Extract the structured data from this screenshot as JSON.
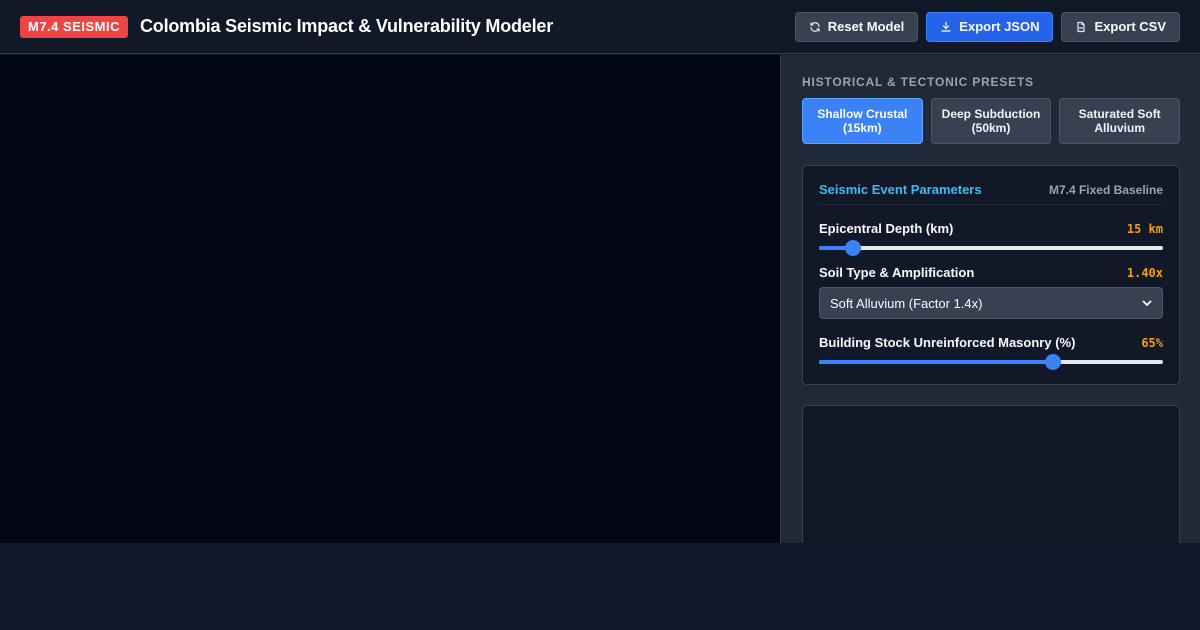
{
  "header": {
    "badge": "M7.4 SEISMIC",
    "title": "Colombia Seismic Impact & Vulnerability Modeler",
    "buttons": {
      "reset": "Reset Model",
      "export_json": "Export JSON",
      "export_csv": "Export CSV"
    }
  },
  "presets": {
    "label": "HISTORICAL & TECTONIC PRESETS",
    "items": [
      {
        "label": "Shallow Crustal (15km)",
        "active": true
      },
      {
        "label": "Deep Subduction (50km)",
        "active": false
      },
      {
        "label": "Saturated Soft Alluvium",
        "active": false
      }
    ]
  },
  "params": {
    "title": "Seismic Event Parameters",
    "subtitle": "M7.4 Fixed Baseline",
    "depth": {
      "label": "Epicentral Depth (km)",
      "value_text": "15 km",
      "fraction": 0.1
    },
    "soil": {
      "label": "Soil Type & Amplification",
      "value_text": "1.40x",
      "selected": "Soft Alluvium (Factor 1.4x)"
    },
    "masonry": {
      "label": "Building Stock Unreinforced Masonry (%)",
      "value_text": "65%",
      "fraction": 0.68
    }
  },
  "colors": {
    "badge": "#ef4444",
    "accent": "#3b82f6",
    "value": "#f59e0b",
    "card_title": "#38bdf8"
  },
  "icons": {
    "reset": "refresh-icon",
    "export_json": "download-icon",
    "export_csv": "file-icon",
    "select": "chevron-down-icon"
  }
}
